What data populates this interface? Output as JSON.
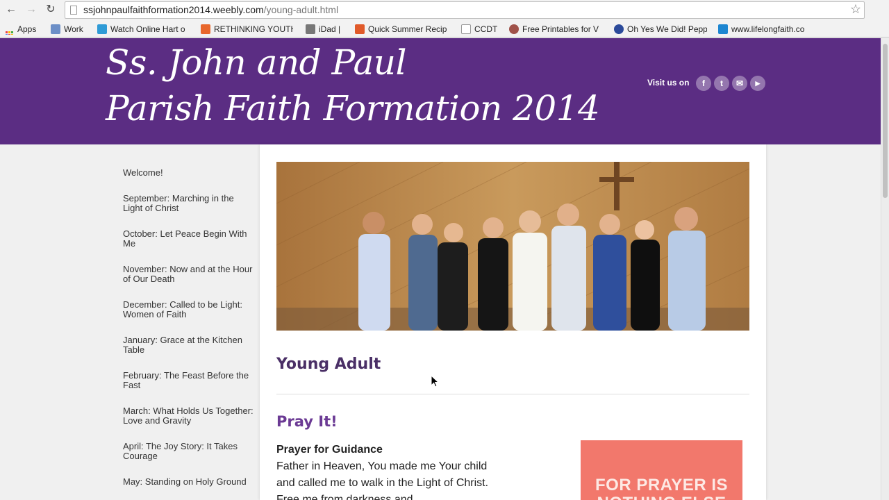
{
  "browser": {
    "url_host": "ssjohnpaulfaithformation2014.weebly.com",
    "url_path": "/young-adult.html",
    "bookmarks": [
      {
        "label": "Apps",
        "color": "#4a7bd0"
      },
      {
        "label": "Work",
        "color": "#6c8fc7"
      },
      {
        "label": "Watch Online Hart o",
        "color": "#2f9bd6"
      },
      {
        "label": "RETHINKING YOUTH",
        "color": "#e8672c"
      },
      {
        "label": "iDad |",
        "color": "#777777"
      },
      {
        "label": "Quick Summer Recip",
        "color": "#e05a2a"
      },
      {
        "label": "CCDT",
        "color": "#999999"
      },
      {
        "label": "Free Printables for V",
        "color": "#a0524a"
      },
      {
        "label": "Oh Yes We Did! Pepp",
        "color": "#2b4a9a"
      },
      {
        "label": "www.lifelongfaith.co",
        "color": "#1d86d1"
      }
    ]
  },
  "header": {
    "title_line1": "Ss. John and Paul",
    "title_line2": "Parish Faith Formation 2014",
    "visit_label": "Visit us on",
    "social": [
      {
        "name": "facebook",
        "glyph": "f"
      },
      {
        "name": "twitter",
        "glyph": "t"
      },
      {
        "name": "email",
        "glyph": "✉"
      },
      {
        "name": "youtube",
        "glyph": "▶"
      }
    ]
  },
  "sidebar": {
    "items": [
      "Welcome!",
      "September: Marching in the Light of Christ",
      "October: Let Peace Begin With Me",
      "November: Now and at the Hour of Our Death",
      "December: Called to be Light: Women of Faith",
      "January: Grace at the Kitchen Table",
      "February: The Feast Before the Fast",
      "March: What Holds Us Together: Love and Gravity",
      "April: The Joy Story: It Takes Courage",
      "May: Standing on Holy Ground"
    ]
  },
  "main": {
    "page_heading": "Young Adult",
    "section_heading": "Pray It!",
    "prayer_title": "Prayer for Guidance",
    "prayer_text": "Father in Heaven, You made me Your child and called me to walk in the Light of Christ. Free me from darkness and",
    "quote_text": "FOR PRAYER IS NOTHING ELSE"
  },
  "colors": {
    "header_bg": "#5b2d83",
    "heading": "#4a2f66",
    "section_heading": "#6b3a94",
    "quote_bg": "#f2786c"
  }
}
